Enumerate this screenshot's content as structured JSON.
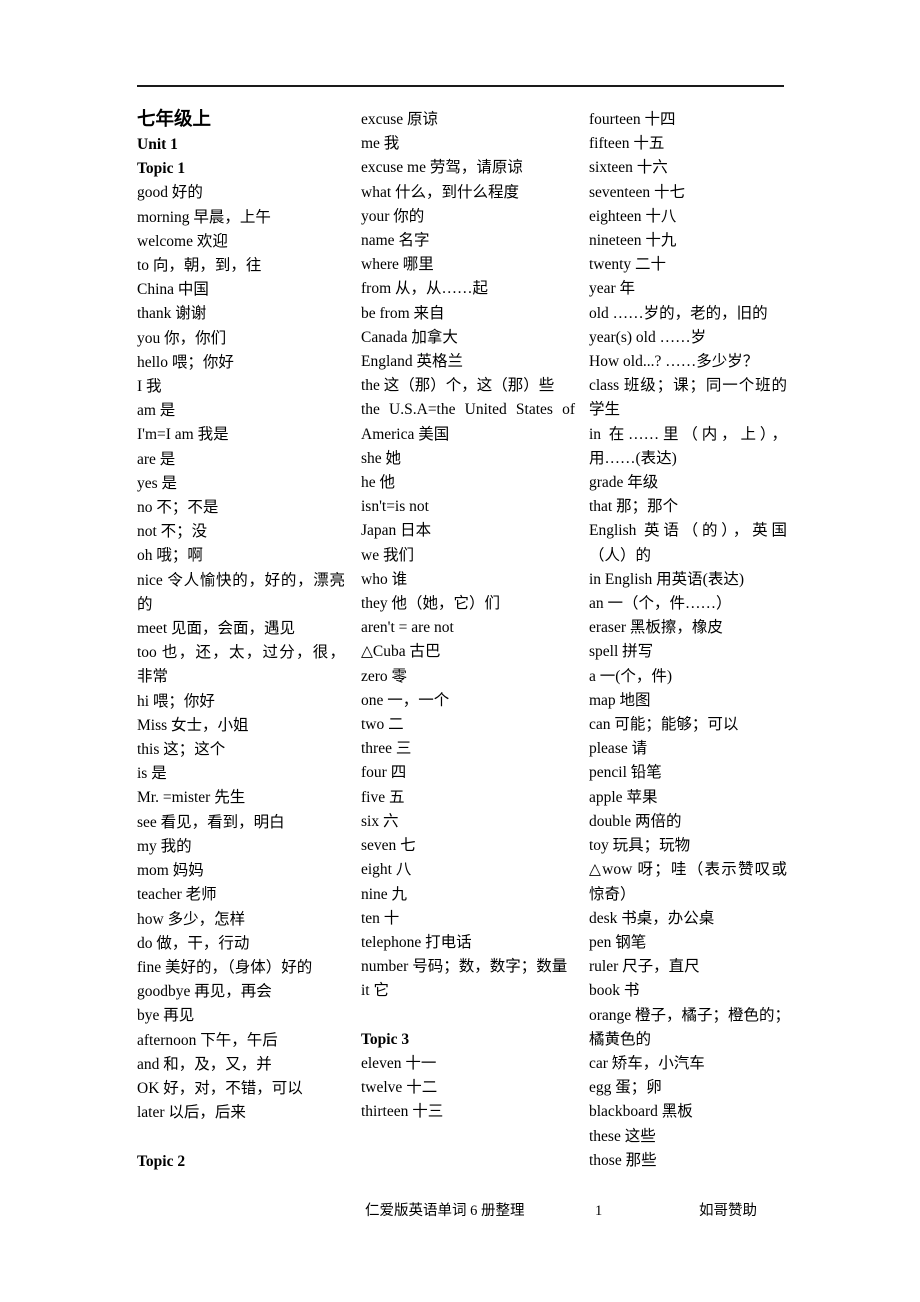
{
  "document": {
    "title": "七年级上",
    "footer": {
      "title": "仁爱版英语单词 6 册整理",
      "page_number": "1",
      "credit": "如哥赞助"
    }
  },
  "columns": [
    {
      "id": "column-1",
      "entries": [
        {
          "text": "七年级上",
          "style": "title"
        },
        {
          "text": "Unit 1",
          "style": "bold"
        },
        {
          "text": "Topic 1",
          "style": "bold"
        },
        {
          "text": "good  好的",
          "style": "normal"
        },
        {
          "text": "morning  早晨，上午",
          "style": "normal"
        },
        {
          "text": "welcome  欢迎",
          "style": "normal"
        },
        {
          "text": "to  向，朝，到，往",
          "style": "normal"
        },
        {
          "text": "China  中国",
          "style": "normal"
        },
        {
          "text": "thank  谢谢",
          "style": "normal"
        },
        {
          "text": "you  你，你们",
          "style": "normal"
        },
        {
          "text": "hello  喂；你好",
          "style": "normal"
        },
        {
          "text": "I  我",
          "style": "normal"
        },
        {
          "text": "am  是",
          "style": "normal"
        },
        {
          "text": "I'm=I am  我是",
          "style": "normal"
        },
        {
          "text": "are  是",
          "style": "normal"
        },
        {
          "text": "yes  是",
          "style": "normal"
        },
        {
          "text": "no  不；不是",
          "style": "normal"
        },
        {
          "text": "not  不；没",
          "style": "normal"
        },
        {
          "text": "oh  哦；啊",
          "style": "normal"
        },
        {
          "text": "nice  令人愉快的，好的，漂亮的",
          "style": "justified"
        },
        {
          "text": "meet  见面，会面，遇见",
          "style": "normal"
        },
        {
          "text": "too  也，还，太，过分，很，非常",
          "style": "justified"
        },
        {
          "text": "hi  喂；你好",
          "style": "normal"
        },
        {
          "text": "Miss  女士，小姐",
          "style": "normal"
        },
        {
          "text": "this  这；这个",
          "style": "normal"
        },
        {
          "text": "is  是",
          "style": "normal"
        },
        {
          "text": "Mr. =mister  先生",
          "style": "normal"
        },
        {
          "text": "see  看见，看到，明白",
          "style": "normal"
        },
        {
          "text": "my  我的",
          "style": "normal"
        },
        {
          "text": "mom  妈妈",
          "style": "normal"
        },
        {
          "text": "teacher  老师",
          "style": "normal"
        },
        {
          "text": "how  多少，怎样",
          "style": "normal"
        },
        {
          "text": "do  做，干，行动",
          "style": "normal"
        },
        {
          "text": "fine  美好的，（身体）好的",
          "style": "normal"
        },
        {
          "text": "goodbye  再见，再会",
          "style": "normal"
        },
        {
          "text": "bye  再见",
          "style": "normal"
        },
        {
          "text": "afternoon  下午，午后",
          "style": "normal"
        },
        {
          "text": "and  和，及，又，并",
          "style": "normal"
        },
        {
          "text": "OK  好，对，不错，可以",
          "style": "normal"
        },
        {
          "text": "later  以后，后来",
          "style": "normal"
        },
        {
          "text": "",
          "style": "spacer"
        },
        {
          "text": "Topic 2",
          "style": "bold"
        }
      ]
    },
    {
      "id": "column-2",
      "entries": [
        {
          "text": "excuse  原谅",
          "style": "normal"
        },
        {
          "text": "me  我",
          "style": "normal"
        },
        {
          "text": "excuse me  劳驾，请原谅",
          "style": "normal"
        },
        {
          "text": "what  什么，到什么程度",
          "style": "normal"
        },
        {
          "text": "your  你的",
          "style": "normal"
        },
        {
          "text": "name  名字",
          "style": "normal"
        },
        {
          "text": "where  哪里",
          "style": "normal"
        },
        {
          "text": "from  从，从……起",
          "style": "normal"
        },
        {
          "text": "be from  来自",
          "style": "normal"
        },
        {
          "text": "Canada  加拿大",
          "style": "normal"
        },
        {
          "text": "England  英格兰",
          "style": "normal"
        },
        {
          "text": "the  这（那）个，这（那）些",
          "style": "justified"
        },
        {
          "text": "the U.S.A=the United States of America  美国",
          "style": "justified"
        },
        {
          "text": "she  她",
          "style": "normal"
        },
        {
          "text": "he  他",
          "style": "normal"
        },
        {
          "text": "isn't=is not",
          "style": "normal"
        },
        {
          "text": "Japan  日本",
          "style": "normal"
        },
        {
          "text": "we  我们",
          "style": "normal"
        },
        {
          "text": "who  谁",
          "style": "normal"
        },
        {
          "text": "they  他（她，它）们",
          "style": "normal"
        },
        {
          "text": "aren't = are not",
          "style": "normal"
        },
        {
          "text": "△Cuba  古巴",
          "style": "normal"
        },
        {
          "text": "zero  零",
          "style": "normal"
        },
        {
          "text": "one  一，一个",
          "style": "normal"
        },
        {
          "text": "two  二",
          "style": "normal"
        },
        {
          "text": "three  三",
          "style": "normal"
        },
        {
          "text": "four  四",
          "style": "normal"
        },
        {
          "text": "five  五",
          "style": "normal"
        },
        {
          "text": "six  六",
          "style": "normal"
        },
        {
          "text": "seven  七",
          "style": "normal"
        },
        {
          "text": "eight  八",
          "style": "normal"
        },
        {
          "text": "nine  九",
          "style": "normal"
        },
        {
          "text": "ten  十",
          "style": "normal"
        },
        {
          "text": "telephone  打电话",
          "style": "normal"
        },
        {
          "text": "number  号码；数，数字；数量",
          "style": "justified"
        },
        {
          "text": "it  它",
          "style": "normal"
        },
        {
          "text": "",
          "style": "spacer"
        },
        {
          "text": "Topic 3",
          "style": "bold"
        },
        {
          "text": "eleven  十一",
          "style": "normal"
        },
        {
          "text": "twelve  十二",
          "style": "normal"
        },
        {
          "text": "thirteen  十三",
          "style": "normal"
        }
      ]
    },
    {
      "id": "column-3",
      "entries": [
        {
          "text": "fourteen  十四",
          "style": "normal"
        },
        {
          "text": "fifteen  十五",
          "style": "normal"
        },
        {
          "text": "sixteen  十六",
          "style": "normal"
        },
        {
          "text": "seventeen  十七",
          "style": "normal"
        },
        {
          "text": "eighteen  十八",
          "style": "normal"
        },
        {
          "text": "nineteen  十九",
          "style": "normal"
        },
        {
          "text": "twenty  二十",
          "style": "normal"
        },
        {
          "text": "year  年",
          "style": "normal"
        },
        {
          "text": "old  ……岁的，老的，旧的",
          "style": "normal"
        },
        {
          "text": "year(s) old ……岁",
          "style": "normal"
        },
        {
          "text": "How old...? ……多少岁？",
          "style": "normal"
        },
        {
          "text": "class  班级；课；同一个班的学生",
          "style": "justified"
        },
        {
          "text": "in  在……里（内，上），用……(表达)",
          "style": "justified"
        },
        {
          "text": "grade  年级",
          "style": "normal"
        },
        {
          "text": "that  那；那个",
          "style": "normal"
        },
        {
          "text": "English  英语（的），英国（人）的",
          "style": "justified"
        },
        {
          "text": "in English 用英语(表达)",
          "style": "normal"
        },
        {
          "text": "an  一（个，件……）",
          "style": "normal"
        },
        {
          "text": "eraser  黑板擦，橡皮",
          "style": "normal"
        },
        {
          "text": "spell  拼写",
          "style": "normal"
        },
        {
          "text": "a  一(个，件)",
          "style": "normal"
        },
        {
          "text": "map  地图",
          "style": "normal"
        },
        {
          "text": "can  可能；能够；可以",
          "style": "normal"
        },
        {
          "text": "please  请",
          "style": "normal"
        },
        {
          "text": "pencil  铅笔",
          "style": "normal"
        },
        {
          "text": "apple  苹果",
          "style": "normal"
        },
        {
          "text": "double  两倍的",
          "style": "normal"
        },
        {
          "text": "toy  玩具；玩物",
          "style": "normal"
        },
        {
          "text": "△wow  呀；哇（表示赞叹或惊奇）",
          "style": "justified"
        },
        {
          "text": "desk  书桌，办公桌",
          "style": "normal"
        },
        {
          "text": "pen  钢笔",
          "style": "normal"
        },
        {
          "text": "ruler  尺子，直尺",
          "style": "normal"
        },
        {
          "text": "book  书",
          "style": "normal"
        },
        {
          "text": "orange  橙子，橘子；橙色的；",
          "style": "overflow"
        },
        {
          "text": "橘黄色的",
          "style": "normal"
        },
        {
          "text": "car  矫车，小汽车",
          "style": "normal"
        },
        {
          "text": "egg  蛋；卵",
          "style": "normal"
        },
        {
          "text": "blackboard  黑板",
          "style": "normal"
        },
        {
          "text": "these  这些",
          "style": "normal"
        },
        {
          "text": "those  那些",
          "style": "normal"
        }
      ]
    }
  ]
}
